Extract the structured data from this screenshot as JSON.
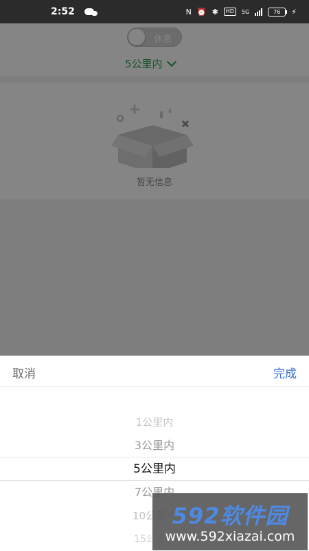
{
  "status_bar": {
    "time": "2:52",
    "network": "5G",
    "battery": "76"
  },
  "top": {
    "toggle_label": "休息",
    "distance": "5公里内"
  },
  "empty_state": {
    "text": "暂无信息"
  },
  "picker_sheet": {
    "cancel_label": "取消",
    "done_label": "完成",
    "options": [
      "1公里内",
      "3公里内",
      "5公里内",
      "7公里内",
      "10公里内",
      "15公里内"
    ],
    "selected": "5公里内"
  },
  "watermark": {
    "logo": "592软件园",
    "url": "www.592xiazai.com"
  },
  "colors": {
    "accent_green": "#2e9b4a",
    "done_blue": "#3a6fd0"
  }
}
